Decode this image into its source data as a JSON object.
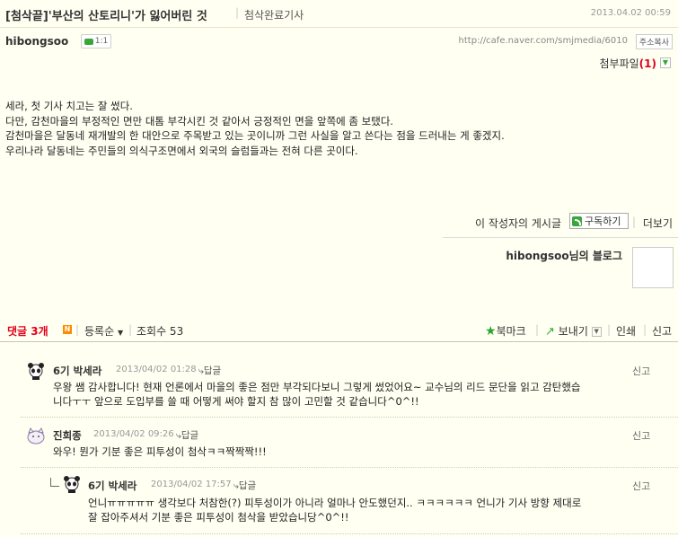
{
  "post": {
    "title": "[첨삭끝]'부산의 산토리니'가 잃어버린 것",
    "category": "첨삭완료기사",
    "date": "2013.04.02 00:59",
    "author": "hibongsoo",
    "talk_count": "1:1",
    "url": "http://cafe.naver.com/smjmedia/6010",
    "copy_address_label": "주소복사",
    "attachment_label": "첨부파일",
    "attachment_count": "(1)",
    "body_lines": [
      "세라, 첫 기사 치고는 잘 썼다.",
      "다만, 감천마을의 부정적인 면만 대톰 부각시킨 것 같아서 긍정적인 면을 앞쪽에 좀 보탰다.",
      "감천마을은 달동네 재개발의 한 대안으로 주목받고 있는 곳이니까 그런 사실을 알고 쓴다는 점을 드러내는 게 좋겠지.",
      "우리나라 달동네는 주민들의 의식구조면에서 외국의 슬럼들과는 전혀 다른 곳이다."
    ]
  },
  "author_bar": {
    "posts_label": "이 작성자의 게시글",
    "subscribe_label": "구독하기",
    "more_label": "더보기",
    "blog_name": "hibongsoo님의 블로그"
  },
  "comment_bar": {
    "count_label": "댓글 3개",
    "new_badge": "N",
    "sort_label": "등록순",
    "views_label": "조회수 53",
    "bookmark_label": "북마크",
    "share_label": "보내기",
    "print_label": "인쇄",
    "report_label": "신고"
  },
  "comments": [
    {
      "name": "6기 박세라",
      "date": "2013/04/02 01:28",
      "reply_label": "답글",
      "report_label": "신고",
      "lines": [
        "우왕 쌤 감사합니다! 현재 언론에서 마을의 좋은 점만 부각되다보니 그렇게 썼었어요~ 교수님의 리드 문단을 읽고 감탄했습",
        "니다ㅜㅜ 앞으로 도입부를 쓸 때 어떻게 써야 할지 참 많이 고민할 것 같습니다^0^!!"
      ]
    },
    {
      "name": "진희종",
      "date": "2013/04/02 09:26",
      "reply_label": "답글",
      "report_label": "신고",
      "lines": [
        "와우! 뭔가 기분 좋은 피투성이 첨삭ㅋㅋ짝짝짝!!!"
      ]
    },
    {
      "name": "6기 박세라",
      "date": "2013/04/02 17:57",
      "reply_label": "답글",
      "report_label": "신고",
      "lines": [
        "언니ㅠㅠㅠㅠㅠ 생각보다 처참한(?) 피투성이가 아니라 얼마나 안도했던지.. ㅋㅋㅋㅋㅋㅋ 언니가 기사 방향 제대로",
        "잘 잡아주셔서 기분 좋은 피투성이 첨삭을 받았습니당^0^!!"
      ]
    }
  ]
}
